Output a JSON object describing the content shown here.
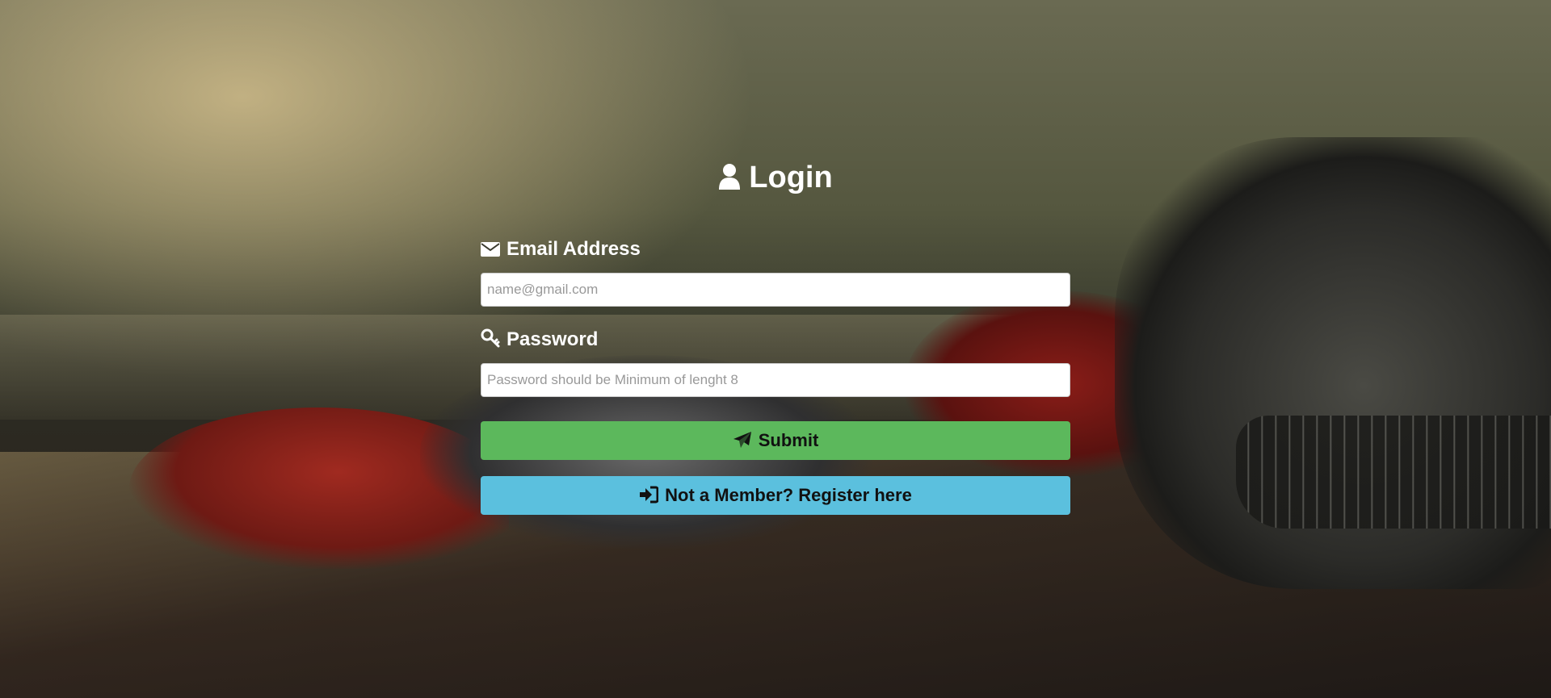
{
  "colors": {
    "submit": "#5cb85c",
    "register": "#5bc0de",
    "text_light": "#ffffff"
  },
  "page": {
    "title": "Login",
    "title_icon": "user-icon"
  },
  "form": {
    "email": {
      "label": "Email Address",
      "icon": "envelope-icon",
      "value": "",
      "placeholder": "name@gmail.com"
    },
    "password": {
      "label": "Password",
      "icon": "key-icon",
      "value": "",
      "placeholder": "Password should be Minimum of lenght 8"
    },
    "submit": {
      "label": "Submit",
      "icon": "paper-plane-icon"
    },
    "register": {
      "label": "Not a Member? Register here",
      "icon": "sign-in-icon"
    }
  }
}
